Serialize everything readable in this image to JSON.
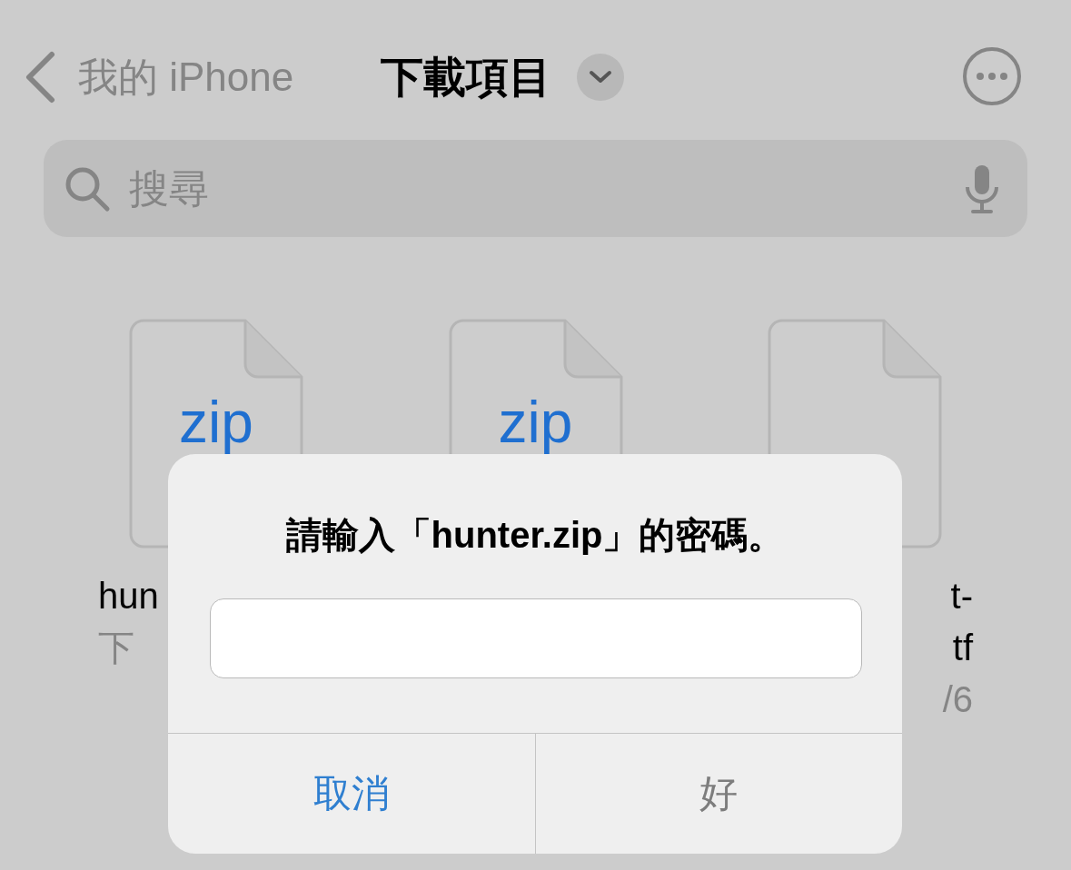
{
  "nav": {
    "back_label": "我的 iPhone",
    "title": "下載項目"
  },
  "search": {
    "placeholder": "搜尋"
  },
  "files": [
    {
      "badge": "zip",
      "name_lines": [
        "hun"
      ],
      "date": "下"
    },
    {
      "badge": "zip"
    },
    {
      "name_lines": [
        "t-",
        "tf"
      ],
      "date": "/6"
    }
  ],
  "dialog": {
    "message": "請輸入「hunter.zip」的密碼。",
    "buttons": [
      {
        "label": "取消",
        "disabled": false
      },
      {
        "label": "好",
        "disabled": true
      }
    ]
  }
}
